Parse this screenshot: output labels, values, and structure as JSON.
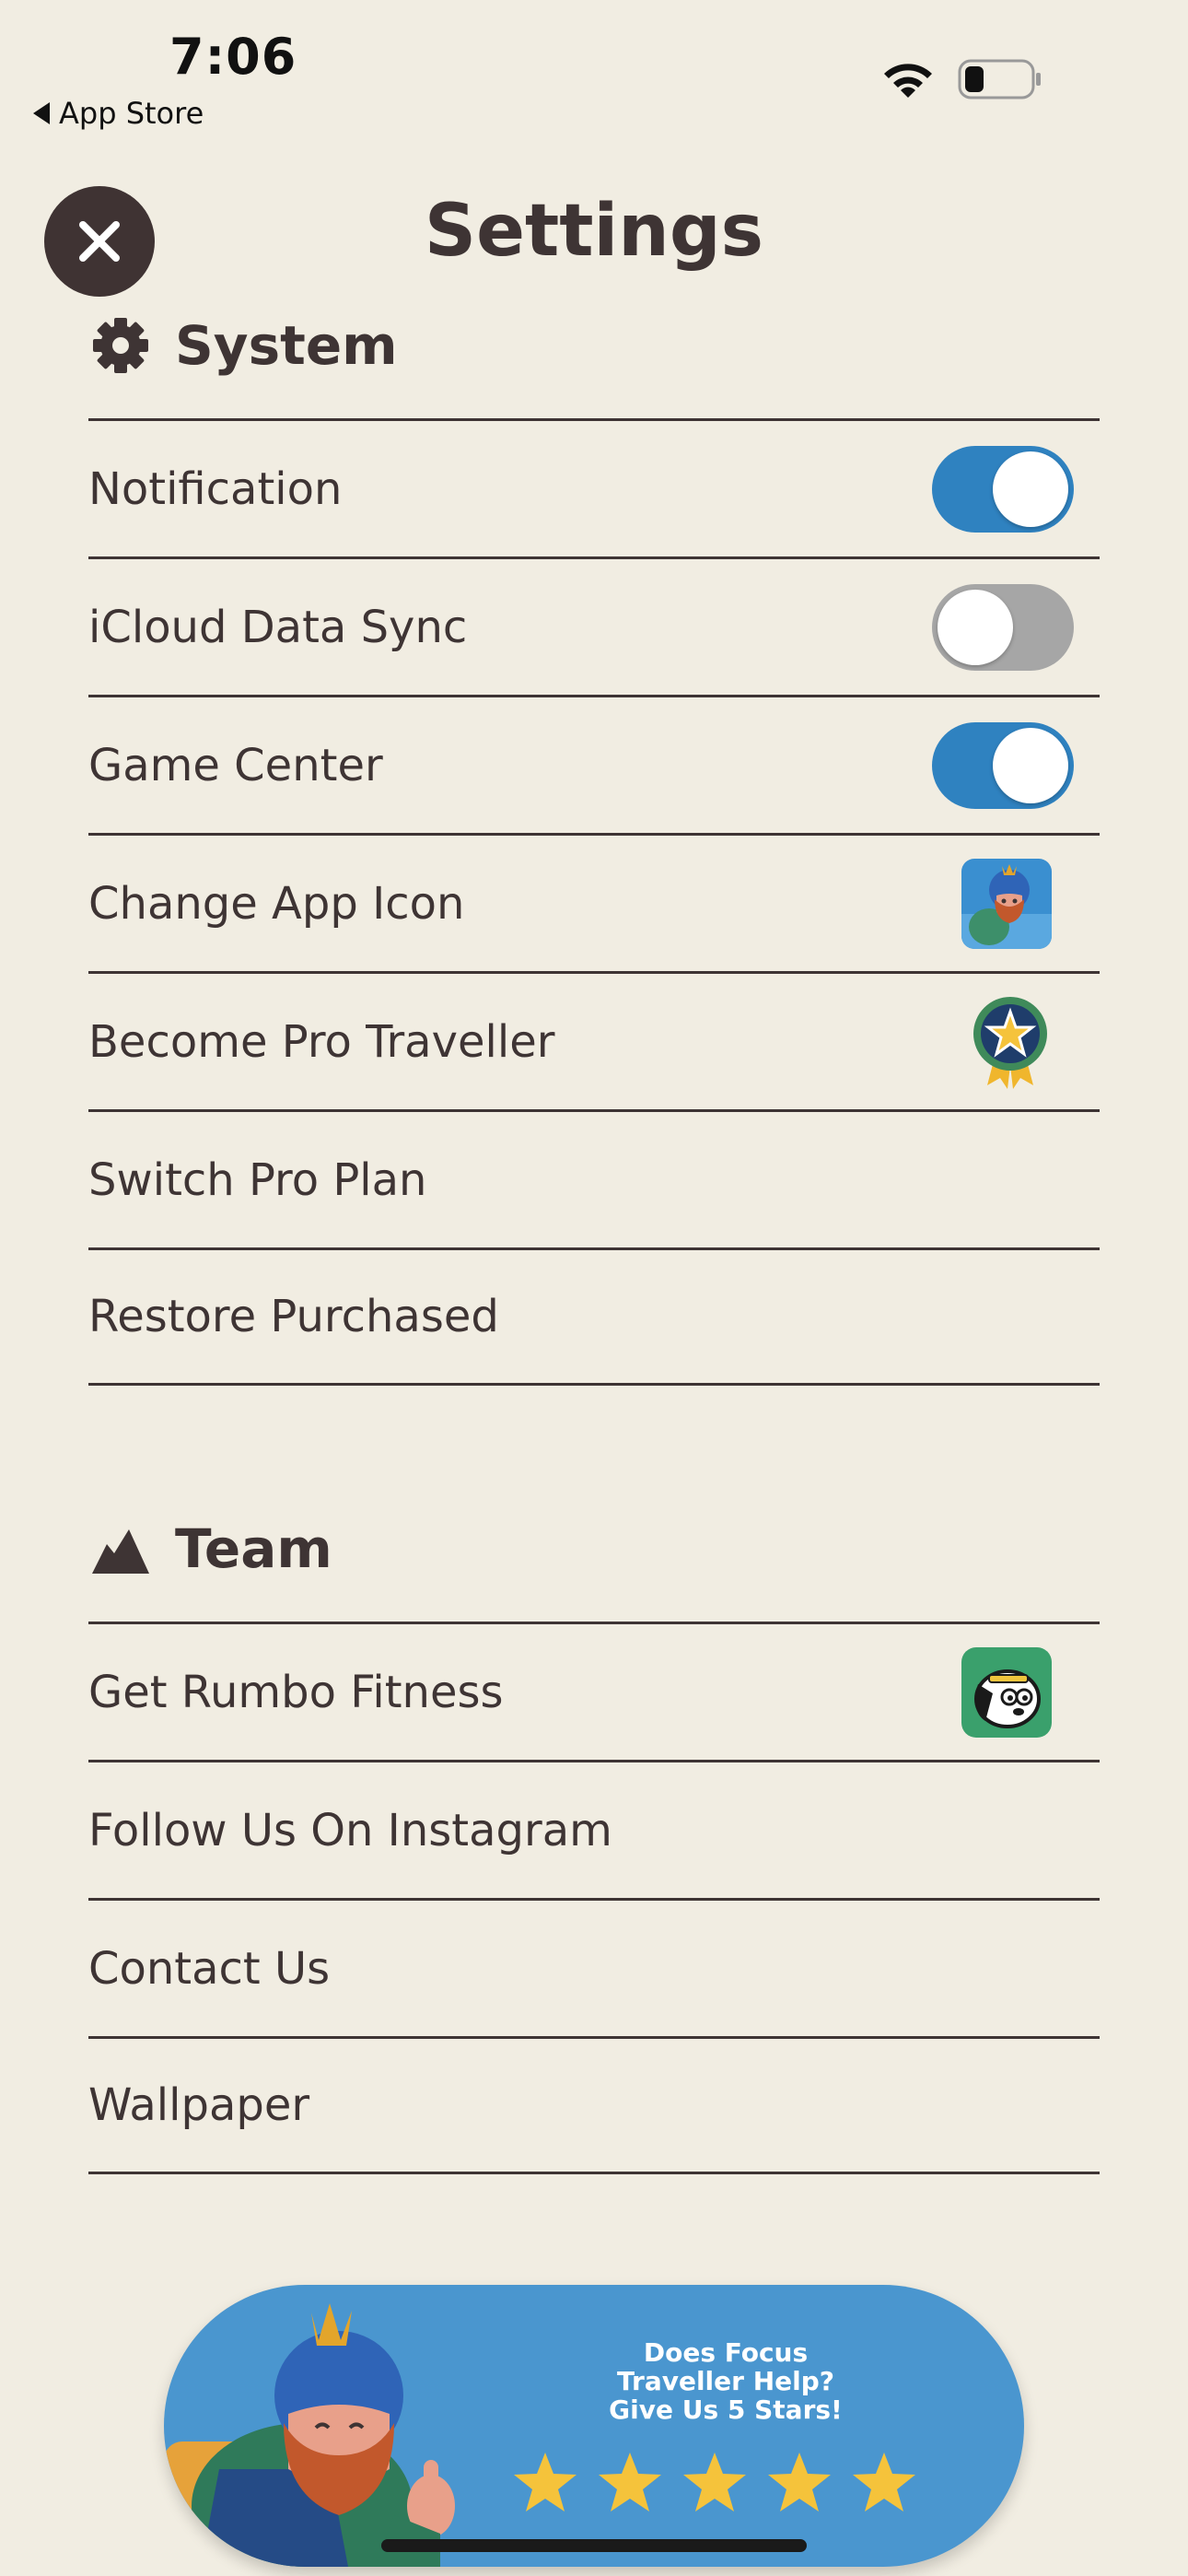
{
  "status_bar": {
    "time": "7:06",
    "back_label": "App Store",
    "icons": [
      "wifi-icon",
      "battery-icon"
    ]
  },
  "header": {
    "title": "Settings",
    "close_icon": "close-icon"
  },
  "system": {
    "title": "System",
    "icon": "gear-icon",
    "rows": [
      {
        "label": "Notification",
        "control": "toggle",
        "on": true
      },
      {
        "label": "iCloud Data Sync",
        "control": "toggle",
        "on": false
      },
      {
        "label": "Game Center",
        "control": "toggle",
        "on": true
      },
      {
        "label": "Change App Icon",
        "control": "app-icon-thumbnail"
      },
      {
        "label": "Become Pro Traveller",
        "control": "pro-badge-icon"
      },
      {
        "label": "Switch Pro Plan"
      },
      {
        "label": "Restore Purchased"
      }
    ]
  },
  "team": {
    "title": "Team",
    "icon": "mountain-icon",
    "rows": [
      {
        "label": "Get Rumbo Fitness",
        "control": "rumbo-app-icon"
      },
      {
        "label": "Follow Us On Instagram"
      },
      {
        "label": "Contact Us"
      },
      {
        "label": "Wallpaper"
      }
    ]
  },
  "rating_banner": {
    "line1": "Does Focus",
    "line2": "Traveller Help?",
    "line3": "Give Us 5 Stars!",
    "star_count": 5
  },
  "colors": {
    "background": "#f1ede2",
    "text": "#3e3434",
    "toggle_on": "#2f82c0",
    "toggle_off": "#a6a6a6",
    "banner": "#4a96cf",
    "star": "#f5c33b"
  }
}
